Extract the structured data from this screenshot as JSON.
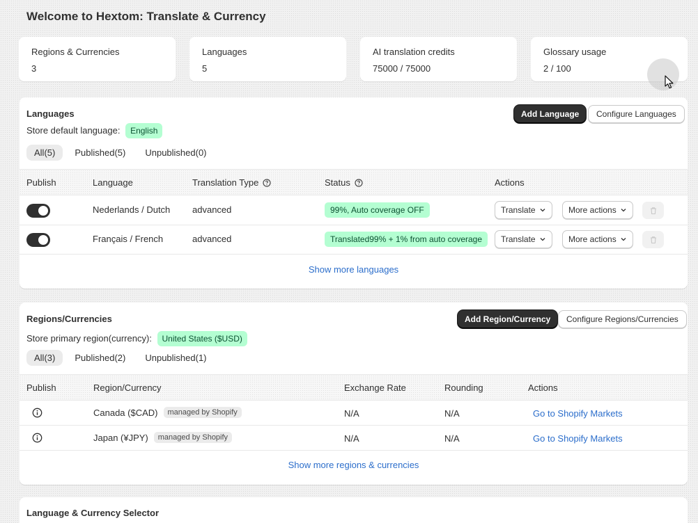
{
  "page": {
    "title": "Welcome to Hextom: Translate & Currency"
  },
  "stats": [
    {
      "label": "Regions & Currencies",
      "value": "3"
    },
    {
      "label": "Languages",
      "value": "5"
    },
    {
      "label": "AI translation credits",
      "value": "75000 / 75000"
    },
    {
      "label": "Glossary usage",
      "value": "2 / 100"
    }
  ],
  "languages": {
    "title": "Languages",
    "add_button": "Add Language",
    "configure_button": "Configure Languages",
    "default_label": "Store default language:",
    "default_value": "English",
    "tabs": [
      "All(5)",
      "Published(5)",
      "Unpublished(0)"
    ],
    "columns": [
      "Publish",
      "Language",
      "Translation Type",
      "Status",
      "Actions"
    ],
    "rows": [
      {
        "language": "Nederlands / Dutch",
        "type": "advanced",
        "status": "99%, Auto coverage OFF",
        "published": true
      },
      {
        "language": "Français / French",
        "type": "advanced",
        "status": "Translated99% + 1% from auto coverage",
        "published": true
      }
    ],
    "translate_label": "Translate",
    "more_actions_label": "More actions",
    "show_more": "Show more languages"
  },
  "regions": {
    "title": "Regions/Currencies",
    "add_button": "Add Region/Currency",
    "configure_button": "Configure Regions/Currencies",
    "primary_label": "Store primary region(currency):",
    "primary_value": "United States ($USD)",
    "tabs": [
      "All(3)",
      "Published(2)",
      "Unpublished(1)"
    ],
    "columns": [
      "Publish",
      "Region/Currency",
      "Exchange Rate",
      "Rounding",
      "Actions"
    ],
    "rows": [
      {
        "region": "Canada ($CAD)",
        "managed": "managed by Shopify",
        "rate": "N/A",
        "rounding": "N/A",
        "action": "Go to Shopify Markets"
      },
      {
        "region": "Japan (¥JPY)",
        "managed": "managed by Shopify",
        "rate": "N/A",
        "rounding": "N/A",
        "action": "Go to Shopify Markets"
      }
    ],
    "show_more": "Show more regions & currencies"
  },
  "selector": {
    "title": "Language & Currency Selector"
  },
  "icons": {
    "help": "question-circle-icon",
    "info": "info-circle-icon",
    "chevron": "chevron-down-icon",
    "trash": "trash-icon",
    "cursor": "mouse-pointer-icon"
  }
}
